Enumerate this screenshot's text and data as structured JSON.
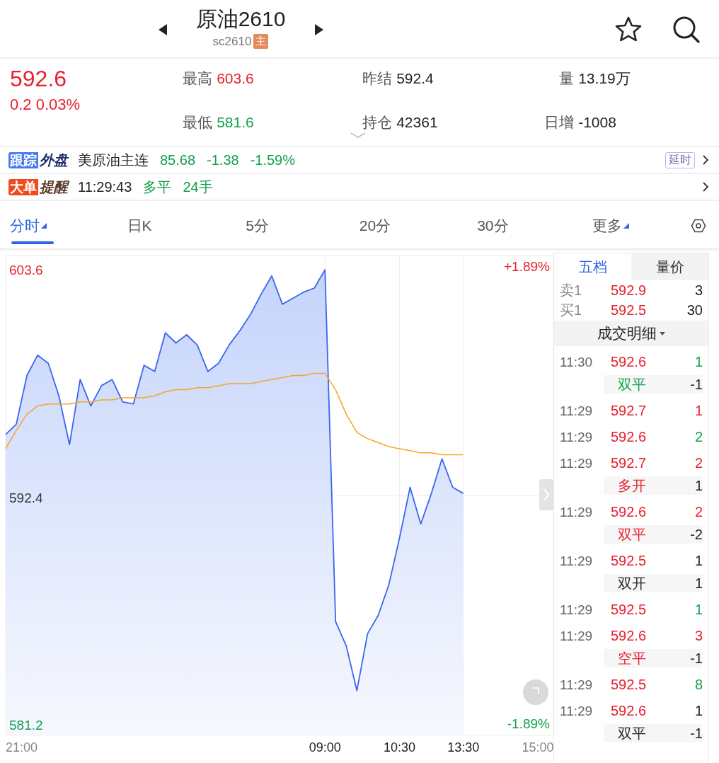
{
  "header": {
    "title": "原油2610",
    "code": "sc2610",
    "badge": "主"
  },
  "quote": {
    "price": "592.6",
    "change": "0.2 0.03%",
    "color": "#e8202e",
    "stats": [
      {
        "label": "最高",
        "value": "603.6",
        "color": "#e8202e"
      },
      {
        "label": "昨结",
        "value": "592.4",
        "color": "#222222"
      },
      {
        "label": "量",
        "value": "13.19万",
        "color": "#222222"
      },
      {
        "label": "最低",
        "value": "581.6",
        "color": "#14a04a"
      },
      {
        "label": "持仓",
        "value": "42361",
        "color": "#222222"
      },
      {
        "label": "日增",
        "value": "-1008",
        "color": "#222222"
      }
    ]
  },
  "tracking": {
    "tag": "跟踪",
    "tag_text": "外盘",
    "name": "美原油主连",
    "values": [
      "85.68",
      "-1.38",
      "-1.59%"
    ],
    "color": "#14a04a",
    "badge": "延时"
  },
  "alert": {
    "tag": "大单",
    "tag_text": "提醒",
    "time": "11:29:43",
    "action": "多平",
    "volume": "24手"
  },
  "tabs": [
    {
      "label": "分时",
      "selected": true,
      "dropdown": true
    },
    {
      "label": "日K",
      "selected": false,
      "dropdown": false
    },
    {
      "label": "5分",
      "selected": false,
      "dropdown": false
    },
    {
      "label": "20分",
      "selected": false,
      "dropdown": false
    },
    {
      "label": "30分",
      "selected": false,
      "dropdown": false
    },
    {
      "label": "更多",
      "selected": false,
      "dropdown": true
    }
  ],
  "chart": {
    "right_labels": [
      {
        "text": "+1.89%",
        "color": "#e8202e"
      },
      {
        "text": "-1.89%",
        "color": "#14a04a"
      }
    ],
    "chart_data": {
      "type": "area",
      "grid": true,
      "categories": [
        "21:00",
        null,
        null,
        null,
        null,
        null,
        null,
        null,
        null,
        null,
        null,
        null,
        null,
        null,
        null,
        null,
        null,
        null,
        null,
        null,
        null,
        null,
        null,
        null,
        null,
        null,
        null,
        null,
        null,
        null,
        "09:00",
        null,
        null,
        null,
        null,
        null,
        null,
        "10:30",
        null,
        null,
        null,
        null,
        null,
        "13:30",
        null,
        null,
        null,
        null,
        null,
        null,
        "15:00"
      ],
      "series": [
        {
          "type": "area",
          "color": "#3a66f0",
          "values": [
            595.4,
            595.9,
            598.3,
            599.3,
            598.9,
            597.3,
            594.9,
            598.1,
            596.8,
            597.8,
            598.1,
            597.0,
            596.9,
            598.8,
            598.5,
            600.4,
            599.9,
            600.3,
            599.8,
            598.5,
            598.9,
            599.8,
            600.5,
            601.3,
            602.3,
            603.2,
            601.8,
            602.1,
            602.4,
            602.6,
            603.5,
            586.2,
            585.0,
            582.8,
            585.6,
            586.5,
            588.0,
            590.3,
            592.8,
            591.0,
            592.5,
            594.2,
            592.8,
            592.5,
            null,
            null,
            null,
            null,
            null,
            null,
            null
          ]
        },
        {
          "type": "line",
          "color": "#f5a623",
          "values": [
            594.7,
            595.6,
            596.4,
            596.8,
            596.9,
            596.9,
            596.9,
            597.0,
            597.0,
            597.1,
            597.1,
            597.2,
            597.2,
            597.2,
            597.3,
            597.5,
            597.6,
            597.6,
            597.7,
            597.7,
            597.8,
            597.9,
            597.9,
            597.9,
            598.0,
            598.1,
            598.2,
            598.3,
            598.3,
            598.4,
            598.4,
            597.6,
            596.4,
            595.5,
            595.2,
            595.0,
            594.8,
            594.7,
            594.6,
            594.5,
            594.5,
            594.4,
            594.4,
            594.4,
            null,
            null,
            null,
            null,
            null,
            null,
            null
          ]
        }
      ],
      "ylim": [
        580.6,
        604.2
      ],
      "yticks": [
        {
          "value": 603.6,
          "label": "603.6"
        },
        {
          "value": 592.4,
          "label": "592.4"
        },
        {
          "value": 581.2,
          "label": "581.2"
        }
      ]
    }
  },
  "panel": {
    "tabs": [
      {
        "label": "五档",
        "selected": true
      },
      {
        "label": "量价",
        "selected": false
      }
    ],
    "book": [
      {
        "label": "卖1",
        "price": "592.9",
        "volume": "3"
      },
      {
        "label": "买1",
        "price": "592.5",
        "volume": "30"
      }
    ],
    "trades_title": "成交明细",
    "trades": [
      {
        "time": "11:30",
        "price": "592.6",
        "volume": "1",
        "color": "#14a04a",
        "detail": {
          "label": "双平",
          "color": "#14a04a",
          "change": "-1"
        }
      },
      {
        "time": "11:29",
        "price": "592.7",
        "volume": "1",
        "color": "#e8202e"
      },
      {
        "time": "11:29",
        "price": "592.6",
        "volume": "2",
        "color": "#14a04a"
      },
      {
        "time": "11:29",
        "price": "592.7",
        "volume": "2",
        "color": "#e8202e",
        "detail": {
          "label": "多开",
          "color": "#e8202e",
          "change": "1"
        }
      },
      {
        "time": "11:29",
        "price": "592.6",
        "volume": "2",
        "color": "#e8202e",
        "detail": {
          "label": "双平",
          "color": "#e8202e",
          "change": "-2"
        }
      },
      {
        "time": "11:29",
        "price": "592.5",
        "volume": "1",
        "color": "#222222",
        "detail": {
          "label": "双开",
          "color": "#222222",
          "change": "1"
        }
      },
      {
        "time": "11:29",
        "price": "592.5",
        "volume": "1",
        "color": "#14a04a"
      },
      {
        "time": "11:29",
        "price": "592.6",
        "volume": "3",
        "color": "#e8202e",
        "detail": {
          "label": "空平",
          "color": "#e8202e",
          "change": "-1"
        }
      },
      {
        "time": "11:29",
        "price": "592.5",
        "volume": "8",
        "color": "#14a04a"
      },
      {
        "time": "11:29",
        "price": "592.6",
        "volume": "1",
        "color": "#222222",
        "detail": {
          "label": "双平",
          "color": "#222222",
          "change": "-1"
        }
      }
    ]
  }
}
